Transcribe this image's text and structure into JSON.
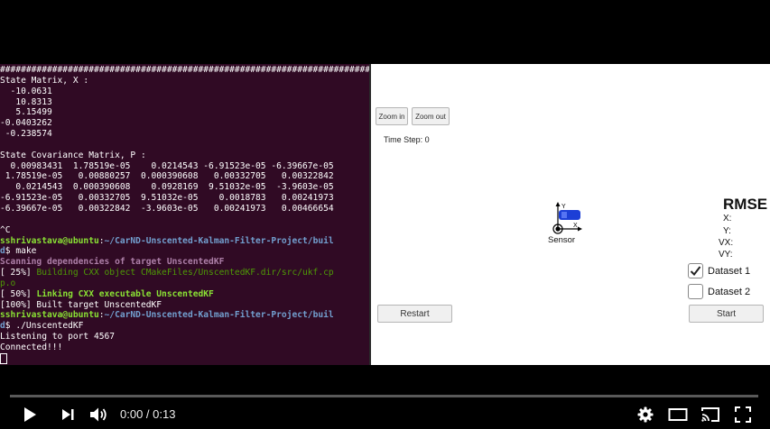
{
  "terminal": {
    "lines": [
      [
        {
          "t": "################################################################################",
          "c": "t-default"
        }
      ],
      [
        {
          "t": "State Matrix, X :",
          "c": "t-default"
        }
      ],
      [
        {
          "t": "  -10.0631",
          "c": "t-default"
        }
      ],
      [
        {
          "t": "   10.8313",
          "c": "t-default"
        }
      ],
      [
        {
          "t": "   5.15499",
          "c": "t-default"
        }
      ],
      [
        {
          "t": "-0.0403262",
          "c": "t-default"
        }
      ],
      [
        {
          "t": " -0.238574",
          "c": "t-default"
        }
      ],
      [
        {
          "t": "",
          "c": "t-default"
        }
      ],
      [
        {
          "t": "State Covariance Matrix, P :",
          "c": "t-default"
        }
      ],
      [
        {
          "t": "  0.00983431  1.78519e-05    0.0214543 -6.91523e-05 -6.39667e-05",
          "c": "t-default"
        }
      ],
      [
        {
          "t": " 1.78519e-05   0.00880257  0.000390608   0.00332705   0.00322842",
          "c": "t-default"
        }
      ],
      [
        {
          "t": "   0.0214543  0.000390608    0.0928169  9.51032e-05  -3.9603e-05",
          "c": "t-default"
        }
      ],
      [
        {
          "t": "-6.91523e-05   0.00332705  9.51032e-05    0.0018783   0.00241973",
          "c": "t-default"
        }
      ],
      [
        {
          "t": "-6.39667e-05   0.00322842  -3.9603e-05   0.00241973   0.00466654",
          "c": "t-default"
        }
      ],
      [
        {
          "t": "",
          "c": "t-default"
        }
      ],
      [
        {
          "t": "^C",
          "c": "t-default"
        }
      ],
      [
        {
          "t": "sshrivastava@ubuntu",
          "c": "t-prompt"
        },
        {
          "t": ":",
          "c": "t-default"
        },
        {
          "t": "~/CarND-Unscented-Kalman-Filter-Project/buil",
          "c": "t-path"
        }
      ],
      [
        {
          "t": "d",
          "c": "t-path"
        },
        {
          "t": "$ make",
          "c": "t-default"
        }
      ],
      [
        {
          "t": "Scanning dependencies of target UnscentedKF",
          "c": "t-magenta"
        }
      ],
      [
        {
          "t": "[ 25%] ",
          "c": "t-default"
        },
        {
          "t": "Building CXX object CMakeFiles/UnscentedKF.dir/src/ukf.cp",
          "c": "t-green"
        }
      ],
      [
        {
          "t": "p.o",
          "c": "t-green"
        }
      ],
      [
        {
          "t": "[ 50%] ",
          "c": "t-default"
        },
        {
          "t": "Linking CXX executable UnscentedKF",
          "c": "t-greenbold"
        }
      ],
      [
        {
          "t": "[100%] Built target UnscentedKF",
          "c": "t-default"
        }
      ],
      [
        {
          "t": "sshrivastava@ubuntu",
          "c": "t-prompt"
        },
        {
          "t": ":",
          "c": "t-default"
        },
        {
          "t": "~/CarND-Unscented-Kalman-Filter-Project/buil",
          "c": "t-path"
        }
      ],
      [
        {
          "t": "d",
          "c": "t-path"
        },
        {
          "t": "$ ./UnscentedKF",
          "c": "t-default"
        }
      ],
      [
        {
          "t": "Listening to port 4567",
          "c": "t-default"
        }
      ],
      [
        {
          "t": "Connected!!!",
          "c": "t-default"
        }
      ]
    ]
  },
  "simulator": {
    "zoom_in_label": "Zoom in",
    "zoom_out_label": "Zoom out",
    "time_step": "Time Step: 0",
    "rmse_title": "RMSE",
    "rmse_labels": {
      "x": "X:",
      "y": "Y:",
      "vx": "VX:",
      "vy": "VY:"
    },
    "sensor_label": "Sensor",
    "axis_y": "Y",
    "axis_x": "X",
    "dataset1_label": "Dataset 1",
    "dataset1_checked": true,
    "dataset2_label": "Dataset 2",
    "dataset2_checked": false,
    "restart_label": "Restart",
    "start_label": "Start",
    "car_color": "#1c3fd6"
  },
  "player": {
    "time_display": "0:00 / 0:13",
    "progress": 0,
    "icons": [
      "play-icon",
      "next-icon",
      "volume-icon",
      "settings-icon",
      "theater-icon",
      "cast-icon",
      "fullscreen-icon"
    ]
  }
}
